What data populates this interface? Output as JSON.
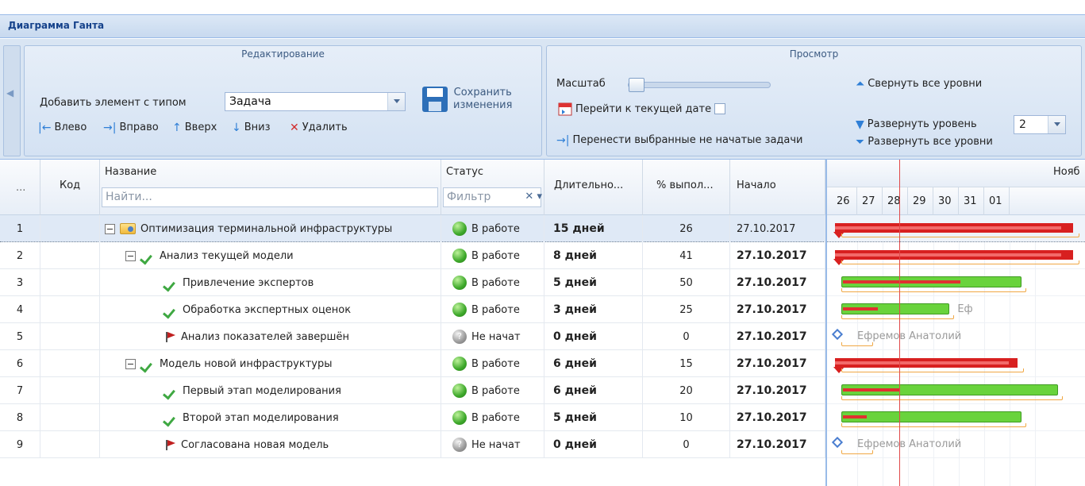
{
  "panel_title": "Диаграмма Ганта",
  "ribbon": {
    "edit": {
      "title": "Редактирование",
      "add_label": "Добавить элемент с типом",
      "type_value": "Задача",
      "left": "Влево",
      "right": "Вправо",
      "up": "Вверх",
      "down": "Вниз",
      "delete": "Удалить",
      "save_line1": "Сохранить",
      "save_line2": "изменения"
    },
    "view": {
      "title": "Просмотр",
      "scale_label": "Масштаб",
      "scale_value": 0,
      "goto_today": "Перейти к текущей дате",
      "move_tasks": "Перенести выбранные не начатые задачи",
      "collapse_all": "Свернуть все уровни",
      "expand_level": "Развернуть уровень",
      "level_value": "2",
      "expand_all": "Развернуть все уровни"
    }
  },
  "columns": {
    "more": "...",
    "code": "Код",
    "name": "Название",
    "name_placeholder": "Найти...",
    "status": "Статус",
    "status_filter": "Фильтр",
    "duration": "Длительно...",
    "percent": "% выпол...",
    "start": "Начало"
  },
  "gantt_header": {
    "month": "Нояб",
    "days": [
      "26",
      "27",
      "28",
      "29",
      "30",
      "31",
      "01"
    ]
  },
  "rows": [
    {
      "num": "1",
      "code": "",
      "name": "Оптимизация терминальной инфраструктуры",
      "level": 0,
      "icon": "folder-icon",
      "expand": true,
      "status": "В работе",
      "status_type": "active",
      "duration": "15 дней",
      "percent": "26",
      "start": "27.10.2017",
      "start_bold": false
    },
    {
      "num": "2",
      "code": "",
      "name": "Анализ текущей модели",
      "level": 1,
      "icon": "check-icon",
      "expand": true,
      "status": "В работе",
      "status_type": "active",
      "duration": "8 дней",
      "percent": "41",
      "start": "27.10.2017",
      "start_bold": true
    },
    {
      "num": "3",
      "code": "",
      "name": "Привлечение экспертов",
      "level": 2,
      "icon": "check-icon",
      "expand": false,
      "status": "В работе",
      "status_type": "active",
      "duration": "5 дней",
      "percent": "50",
      "start": "27.10.2017",
      "start_bold": true
    },
    {
      "num": "4",
      "code": "",
      "name": "Обработка экспертных оценок",
      "level": 2,
      "icon": "check-icon",
      "expand": false,
      "status": "В работе",
      "status_type": "active",
      "duration": "3 дней",
      "percent": "25",
      "start": "27.10.2017",
      "start_bold": true
    },
    {
      "num": "5",
      "code": "",
      "name": "Анализ показателей завершён",
      "level": 2,
      "icon": "flag-icon",
      "expand": false,
      "status": "Не начат",
      "status_type": "notstarted",
      "duration": "0 дней",
      "percent": "0",
      "start": "27.10.2017",
      "start_bold": true
    },
    {
      "num": "6",
      "code": "",
      "name": "Модель новой инфраструктуры",
      "level": 1,
      "icon": "check-icon",
      "expand": true,
      "status": "В работе",
      "status_type": "active",
      "duration": "6 дней",
      "percent": "15",
      "start": "27.10.2017",
      "start_bold": true
    },
    {
      "num": "7",
      "code": "",
      "name": "Первый этап моделирования",
      "level": 2,
      "icon": "check-icon",
      "expand": false,
      "status": "В работе",
      "status_type": "active",
      "duration": "6 дней",
      "percent": "20",
      "start": "27.10.2017",
      "start_bold": true
    },
    {
      "num": "8",
      "code": "",
      "name": "Второй этап моделирования",
      "level": 2,
      "icon": "check-icon",
      "expand": false,
      "status": "В работе",
      "status_type": "active",
      "duration": "5 дней",
      "percent": "10",
      "start": "27.10.2017",
      "start_bold": true
    },
    {
      "num": "9",
      "code": "",
      "name": "Согласована новая модель",
      "level": 2,
      "icon": "flag-icon",
      "expand": false,
      "status": "Не начат",
      "status_type": "notstarted",
      "duration": "0 дней",
      "percent": "0",
      "start": "27.10.2017",
      "start_bold": true
    }
  ],
  "gantt_rows": [
    {
      "kind": "summary",
      "start_day": 1,
      "days": 15,
      "progress": 26
    },
    {
      "kind": "summary",
      "start_day": 1,
      "days": 8,
      "progress": 41
    },
    {
      "kind": "task",
      "start_day": 1,
      "days": 5,
      "progress": 50
    },
    {
      "kind": "task",
      "start_day": 1,
      "days": 3,
      "progress": 25,
      "resource": "Еф"
    },
    {
      "kind": "milestone",
      "start_day": 1,
      "resource": "Ефремов Анатолий"
    },
    {
      "kind": "summary",
      "start_day": 1,
      "days": 6,
      "progress": 15
    },
    {
      "kind": "task",
      "start_day": 1,
      "days": 6,
      "progress": 20
    },
    {
      "kind": "task",
      "start_day": 1,
      "days": 5,
      "progress": 10
    },
    {
      "kind": "milestone",
      "start_day": 1,
      "resource": "Ефремов Анатолий"
    }
  ],
  "colors": {
    "accent": "#15428b",
    "bar_green": "#69d33c",
    "bar_red": "#d82020",
    "today_line": "#e04848"
  }
}
